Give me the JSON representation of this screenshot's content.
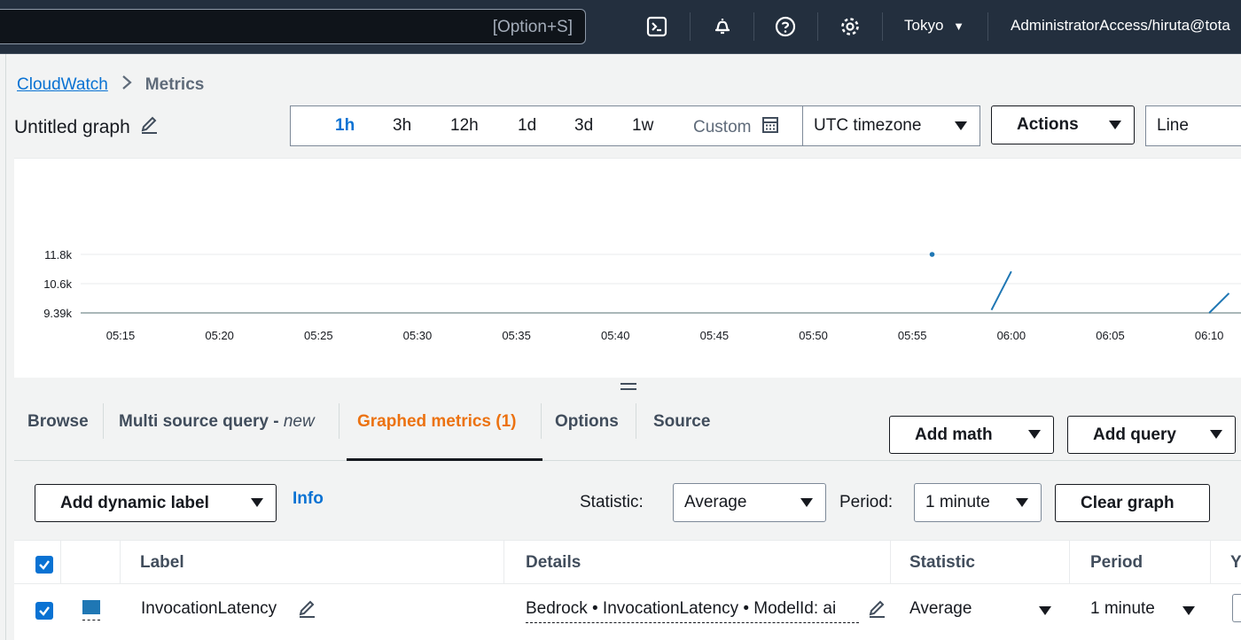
{
  "topbar": {
    "search_hint": "[Option+S]",
    "region": "Tokyo",
    "account": "AdministratorAccess/hiruta@tota",
    "icons": [
      "cloudshell-icon",
      "bell-icon",
      "help-icon",
      "gear-icon"
    ]
  },
  "breadcrumb": {
    "root": "CloudWatch",
    "current": "Metrics"
  },
  "graph": {
    "title": "Untitled graph"
  },
  "time_range": {
    "options": [
      "1h",
      "3h",
      "12h",
      "1d",
      "3d",
      "1w"
    ],
    "active": "1h",
    "custom_label": "Custom"
  },
  "timezone": "UTC timezone",
  "actions_label": "Actions",
  "chart_type_select": "Line",
  "chart_data": {
    "type": "line",
    "x_ticks": [
      "05:15",
      "05:20",
      "05:25",
      "05:30",
      "05:35",
      "05:40",
      "05:45",
      "05:50",
      "05:55",
      "06:00",
      "06:05",
      "06:10"
    ],
    "y_ticks": [
      "11.8k",
      "10.6k",
      "9.39k"
    ],
    "ylim": [
      9390,
      11800
    ],
    "series": [
      {
        "name": "InvocationLatency",
        "color": "#1f77b4",
        "points": [
          {
            "x": "05:56",
            "y": 11800
          },
          {
            "x": "05:59",
            "y": 9510
          },
          {
            "x": "06:00",
            "y": 11100
          },
          {
            "x": "06:10",
            "y": 9390
          },
          {
            "x": "06:11",
            "y": 10200
          }
        ]
      }
    ]
  },
  "tabs": {
    "browse": "Browse",
    "multi_source": "Multi source query - ",
    "multi_source_new": "new",
    "graphed": "Graphed metrics (1)",
    "options": "Options",
    "source": "Source",
    "active": "graphed"
  },
  "buttons": {
    "add_math": "Add math",
    "add_query": "Add query",
    "add_dynamic_label": "Add dynamic label",
    "info": "Info",
    "clear_graph": "Clear graph"
  },
  "controls": {
    "statistic_label": "Statistic:",
    "statistic_value": "Average",
    "period_label": "Period:",
    "period_value": "1 minute"
  },
  "table": {
    "headers": {
      "label": "Label",
      "details": "Details",
      "statistic": "Statistic",
      "period": "Period",
      "y": "Y"
    },
    "rows": [
      {
        "label": "InvocationLatency",
        "details": "Bedrock • InvocationLatency • ModelId: ai",
        "statistic": "Average",
        "period": "1 minute",
        "color": "#1f77b4"
      }
    ]
  }
}
